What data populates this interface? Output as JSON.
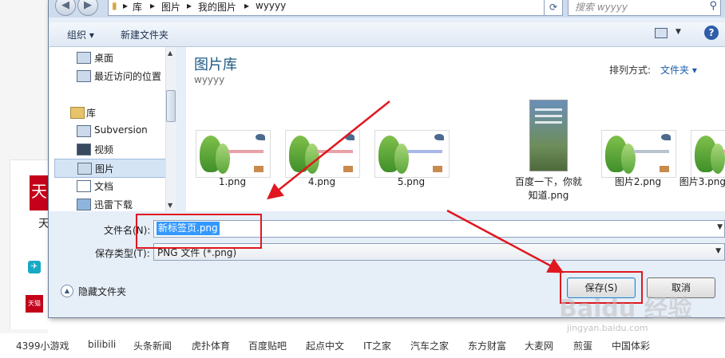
{
  "address_bar": {
    "back_label": "◀",
    "forward_label": "▶",
    "crumbs": [
      "库",
      "图片",
      "我的图片",
      "wyyyy"
    ],
    "search_placeholder": "搜索 wyyyy"
  },
  "toolbar": {
    "organize_label": "组织 ▾",
    "new_folder_label": "新建文件夹"
  },
  "sidebar": {
    "items": [
      {
        "label": "桌面",
        "icon": "desktop-icon"
      },
      {
        "label": "最近访问的位置",
        "icon": "recent-places-icon"
      },
      {
        "label": "库",
        "icon": "library-icon"
      },
      {
        "label": "Subversion",
        "icon": "document-library-icon"
      },
      {
        "label": "视频",
        "icon": "video-icon"
      },
      {
        "label": "图片",
        "icon": "pictures-icon",
        "selected": true
      },
      {
        "label": "文档",
        "icon": "documents-icon"
      },
      {
        "label": "迅雷下载",
        "icon": "download-icon"
      }
    ]
  },
  "content": {
    "library_title": "图片库",
    "library_subtitle": "wyyyy",
    "sort_label": "排列方式:",
    "sort_value": "文件夹 ▾",
    "files": [
      {
        "name": "1.png",
        "kind": "landscape"
      },
      {
        "name": "4.png",
        "kind": "landscape"
      },
      {
        "name": "5.png",
        "kind": "landscape"
      },
      {
        "name_line1": "百度一下，你就",
        "name_line2": "知道.png",
        "kind": "portrait"
      },
      {
        "name": "图片2.png",
        "kind": "landscape"
      },
      {
        "name": "图片3.png",
        "kind": "landscape"
      }
    ]
  },
  "save_form": {
    "filename_label": "文件名(N):",
    "filename_value": "新标签页.png",
    "filetype_label": "保存类型(T):",
    "filetype_value": "PNG 文件 (*.png)",
    "hide_folders_label": "隐藏文件夹",
    "save_button": "保存(S)",
    "cancel_button": "取消"
  },
  "background": {
    "tmall_char": "天",
    "partial_char": "天",
    "tmall_small": "天猫",
    "links": [
      "4399小游戏",
      "bilibili",
      "头条新闻",
      "虎扑体育",
      "百度贴吧",
      "起点中文",
      "IT之家",
      "汽车之家",
      "东方财富",
      "大麦网",
      "煎蛋",
      "中国体彩"
    ]
  },
  "watermark": {
    "main": "Baidu 经验",
    "sub": "jingyan.baidu.com"
  },
  "colors": {
    "annotation_red": "#e0171f",
    "selection_blue": "#3399ff",
    "library_title": "#1d5a84"
  }
}
